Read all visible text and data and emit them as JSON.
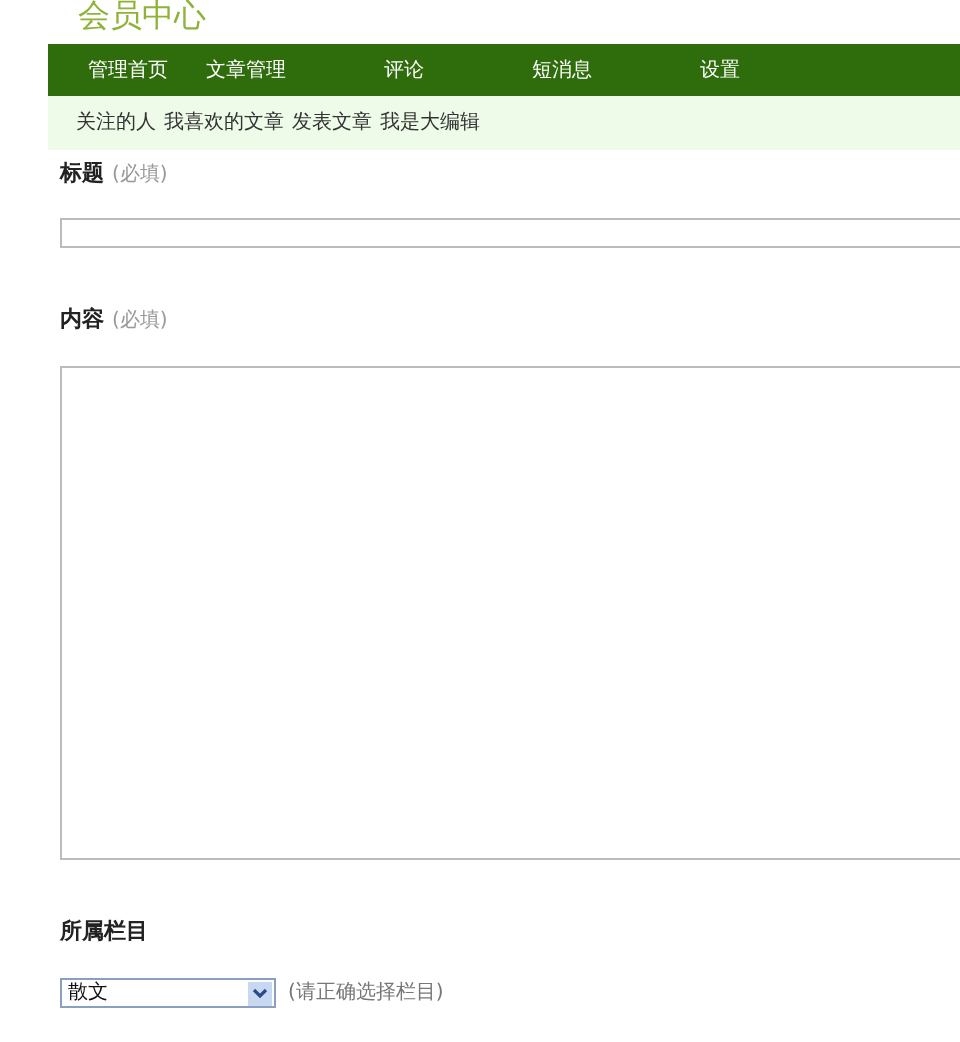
{
  "site_title": "会员中心",
  "nav": [
    {
      "label": "管理首页"
    },
    {
      "label": "文章管理"
    },
    {
      "label": "评论"
    },
    {
      "label": "短消息"
    },
    {
      "label": "设置"
    }
  ],
  "sub_nav": [
    {
      "label": "关注的人"
    },
    {
      "label": "我喜欢的文章"
    },
    {
      "label": "发表文章"
    },
    {
      "label": "我是大编辑"
    }
  ],
  "form": {
    "title_field": {
      "label": "标题",
      "hint": "(必填)"
    },
    "content_field": {
      "label": "内容",
      "hint": "(必填)"
    },
    "category_field": {
      "label": "所属栏目",
      "value": "散文",
      "hint": "(请正确选择栏目)"
    }
  }
}
